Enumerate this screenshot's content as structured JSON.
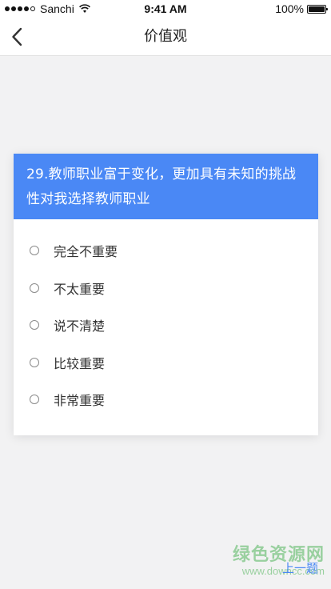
{
  "status_bar": {
    "carrier": "Sanchi",
    "time": "9:41 AM",
    "battery": "100%",
    "signal_icon": "signal-dots-icon",
    "wifi_icon": "wifi-icon",
    "battery_icon": "battery-icon"
  },
  "nav": {
    "back_icon": "chevron-left-icon",
    "title": "价值观"
  },
  "question": {
    "text": "29.教师职业富于变化，更加具有未知的挑战性对我选择教师职业",
    "header_color": "#4a88f5"
  },
  "options": [
    {
      "label": "完全不重要"
    },
    {
      "label": "不太重要"
    },
    {
      "label": "说不清楚"
    },
    {
      "label": "比较重要"
    },
    {
      "label": "非常重要"
    }
  ],
  "footer": {
    "prev_label": "上一题"
  },
  "watermark": {
    "text": "绿色资源网",
    "url": "www.downcc.com"
  }
}
